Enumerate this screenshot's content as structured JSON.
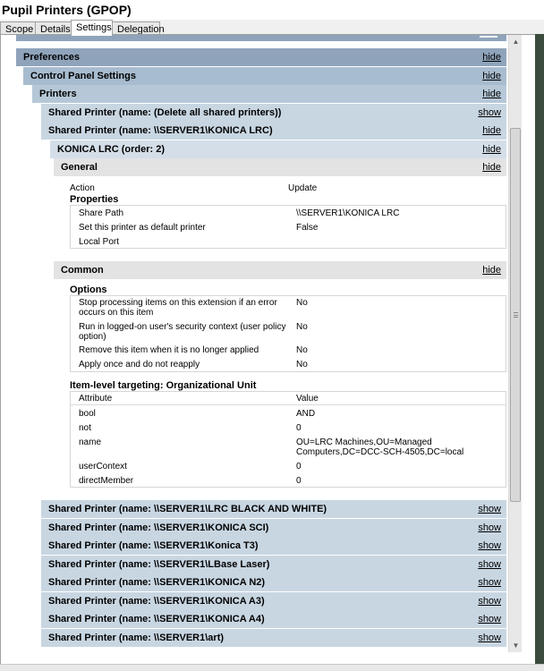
{
  "window": {
    "title": "Pupil Printers (GPOP)"
  },
  "tabs": [
    "Scope",
    "Details",
    "Settings",
    "Delegation"
  ],
  "links": {
    "hide": "hide",
    "show": "show"
  },
  "tree": {
    "preferences": "Preferences",
    "control_panel": "Control Panel Settings",
    "printers": "Printers",
    "shared_delete_all": "Shared Printer (name: (Delete all shared printers))",
    "shared_konica_lrc": "Shared Printer (name: \\\\SERVER1\\KONICA LRC)",
    "konica_lrc_order": "KONICA LRC (order: 2)"
  },
  "general": {
    "header": "General",
    "action_label": "Action",
    "action_value": "Update",
    "properties_label": "Properties",
    "properties": [
      {
        "label": "Share Path",
        "value": "\\\\SERVER1\\KONICA LRC"
      },
      {
        "label": "Set this printer as default printer",
        "value": "False"
      },
      {
        "label": "Local Port",
        "value": ""
      }
    ]
  },
  "common": {
    "header": "Common",
    "options_label": "Options",
    "options": [
      {
        "label": "Stop processing items on this extension if an error occurs on this item",
        "value": "No"
      },
      {
        "label": "Run in logged-on user's security context (user policy option)",
        "value": "No"
      },
      {
        "label": "Remove this item when it is no longer applied",
        "value": "No"
      },
      {
        "label": "Apply once and do not reapply",
        "value": "No"
      }
    ],
    "targeting_label": "Item-level targeting: Organizational Unit",
    "targeting_headers": {
      "attribute": "Attribute",
      "value": "Value"
    },
    "targeting": [
      {
        "attribute": "bool",
        "value": "AND"
      },
      {
        "attribute": "not",
        "value": "0"
      },
      {
        "attribute": "name",
        "value": "OU=LRC Machines,OU=Managed Computers,DC=DCC-SCH-4505,DC=local"
      },
      {
        "attribute": "userContext",
        "value": "0"
      },
      {
        "attribute": "directMember",
        "value": "0"
      }
    ]
  },
  "other_printers": [
    "Shared Printer (name: \\\\SERVER1\\LRC BLACK AND WHITE)",
    "Shared Printer (name: \\\\SERVER1\\KONICA SCI)",
    "Shared Printer (name: \\\\SERVER1\\Konica T3)",
    "Shared Printer (name: \\\\SERVER1\\LBase Laser)",
    "Shared Printer (name: \\\\SERVER1\\KONICA N2)",
    "Shared Printer (name: \\\\SERVER1\\KONICA A3)",
    "Shared Printer (name: \\\\SERVER1\\KONICA A4)",
    "Shared Printer (name: \\\\SERVER1\\art)"
  ]
}
